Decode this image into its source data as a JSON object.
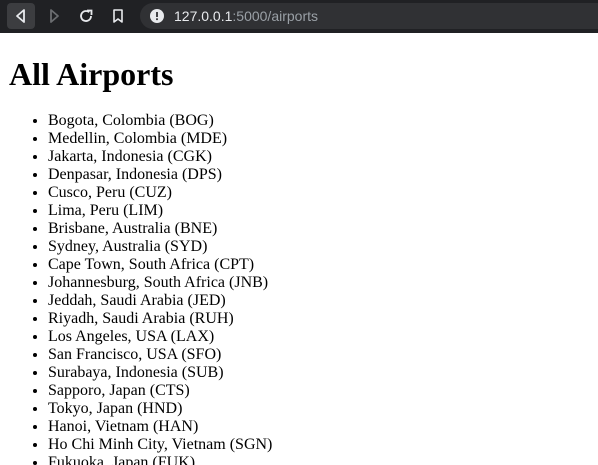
{
  "browser": {
    "url_host": "127.0.0.1",
    "url_rest": ":5000/airports"
  },
  "page": {
    "heading": "All Airports",
    "airports": [
      "Bogota, Colombia (BOG)",
      "Medellin, Colombia (MDE)",
      "Jakarta, Indonesia (CGK)",
      "Denpasar, Indonesia (DPS)",
      "Cusco, Peru (CUZ)",
      "Lima, Peru (LIM)",
      "Brisbane, Australia (BNE)",
      "Sydney, Australia (SYD)",
      "Cape Town, South Africa (CPT)",
      "Johannesburg, South Africa (JNB)",
      "Jeddah, Saudi Arabia (JED)",
      "Riyadh, Saudi Arabia (RUH)",
      "Los Angeles, USA (LAX)",
      "San Francisco, USA (SFO)",
      "Surabaya, Indonesia (SUB)",
      "Sapporo, Japan (CTS)",
      "Tokyo, Japan (HND)",
      "Hanoi, Vietnam (HAN)",
      "Ho Chi Minh City, Vietnam (SGN)",
      "Fukuoka, Japan (FUK)"
    ]
  },
  "colors": {
    "toolbar_bg": "#202124",
    "omnibox_bg": "#303134",
    "url_host": "#e8eaed",
    "url_path": "#9aa0a6"
  }
}
